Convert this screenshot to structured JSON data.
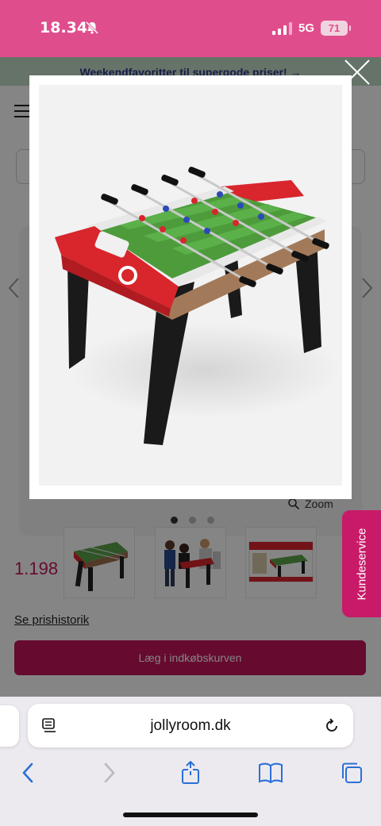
{
  "status_bar": {
    "time": "18.34",
    "network": "5G",
    "battery": "71"
  },
  "promo_banner": {
    "text": "Weekendfavoritter til supergode priser! →"
  },
  "gallery": {
    "zoom_label": "Zoom",
    "dots_count": 3,
    "active_dot": 1
  },
  "product": {
    "price": "1.198",
    "price_history_link": "Se prishistorik",
    "add_to_cart_label": "Læg i indkøbskurven"
  },
  "kundeservice": {
    "label": "Kundeservice"
  },
  "browser": {
    "url": "jollyroom.dk"
  },
  "colors": {
    "brand_pink": "#e04d8c",
    "cart_magenta": "#c4145a",
    "kundeservice": "#c81a68"
  }
}
